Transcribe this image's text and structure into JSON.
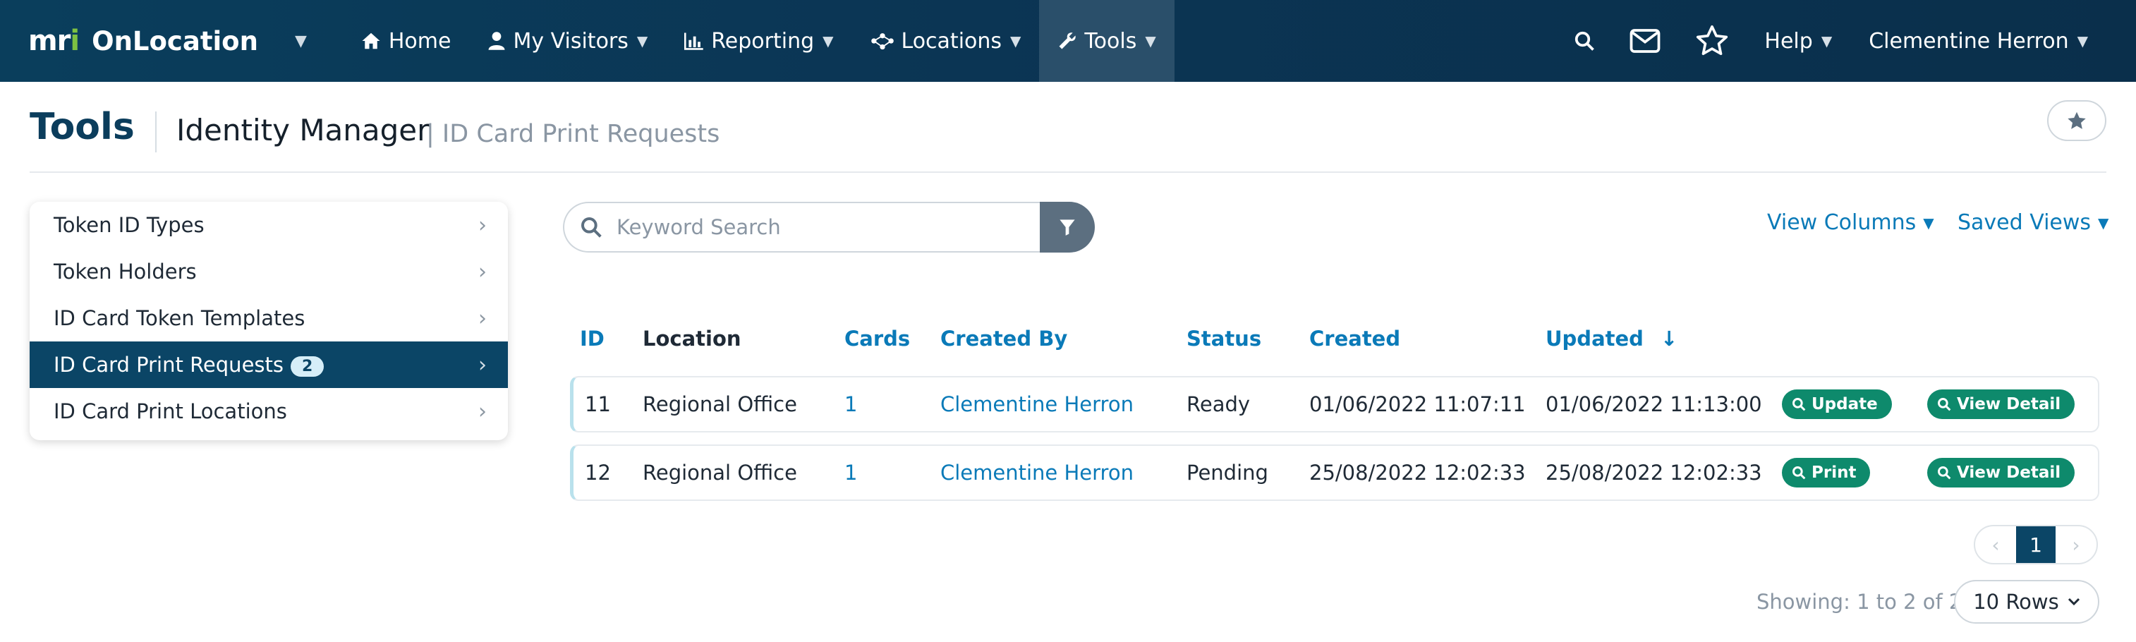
{
  "navbar": {
    "brand_logo": "mri",
    "brand_name": "OnLocation",
    "items": [
      {
        "label": "Home",
        "icon": "home-icon"
      },
      {
        "label": "My Visitors",
        "icon": "user-icon"
      },
      {
        "label": "Reporting",
        "icon": "bar-chart-icon"
      },
      {
        "label": "Locations",
        "icon": "network-icon"
      },
      {
        "label": "Tools",
        "icon": "wrench-icon"
      }
    ],
    "help_label": "Help",
    "user_name": "Clementine Herron"
  },
  "header": {
    "title": "Tools",
    "section": "Identity Manager",
    "subsection": "| ID Card Print Requests"
  },
  "sidebar": {
    "items": [
      {
        "label": "Token ID Types"
      },
      {
        "label": "Token Holders"
      },
      {
        "label": "ID Card Token Templates"
      },
      {
        "label": "ID Card Print Requests",
        "badge": "2"
      },
      {
        "label": "ID Card Print Locations"
      }
    ]
  },
  "search": {
    "placeholder": "Keyword Search",
    "value": ""
  },
  "toolbar": {
    "view_columns": "View Columns",
    "saved_views": "Saved Views"
  },
  "table": {
    "columns": [
      "ID",
      "Location",
      "Cards",
      "Created By",
      "Status",
      "Created",
      "Updated"
    ],
    "sort_indicator": "↓",
    "rows": [
      {
        "id": "11",
        "location": "Regional Office",
        "cards": "1",
        "created_by": "Clementine Herron",
        "status": "Ready",
        "created": "01/06/2022 11:07:11",
        "updated": "01/06/2022 11:13:00",
        "action": "Update",
        "detail": "View Detail"
      },
      {
        "id": "12",
        "location": "Regional Office",
        "cards": "1",
        "created_by": "Clementine Herron",
        "status": "Pending",
        "created": "25/08/2022 12:02:33",
        "updated": "25/08/2022 12:02:33",
        "action": "Print",
        "detail": "View Detail"
      }
    ]
  },
  "pagination": {
    "current_page": "1",
    "prev": "‹",
    "next": "›",
    "showing": "Showing: 1 to 2 of 2",
    "rows_per_page": "10 Rows"
  },
  "colors": {
    "navbar": "#0b3554",
    "active_sidebar": "#0b4566",
    "link": "#0a7ab8",
    "action_pill": "#0e8a6c"
  }
}
